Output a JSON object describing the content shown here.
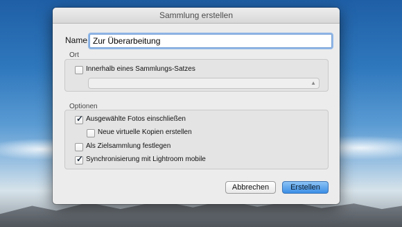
{
  "dialog": {
    "title": "Sammlung erstellen",
    "name_label": "Name:",
    "name_value": "Zur Überarbeitung"
  },
  "ort": {
    "label": "Ort",
    "inside_set_label": "Innerhalb eines Sammlungs-Satzes",
    "inside_set_checked": false,
    "set_select_value": ""
  },
  "optionen": {
    "label": "Optionen",
    "items": [
      {
        "label": "Ausgewählte Fotos einschließen",
        "checked": true
      },
      {
        "label": "Neue virtuelle Kopien erstellen",
        "checked": false
      },
      {
        "label": "Als Zielsammlung festlegen",
        "checked": false
      },
      {
        "label": "Synchronisierung mit Lightroom mobile",
        "checked": true
      }
    ]
  },
  "buttons": {
    "cancel": "Abbrechen",
    "create": "Erstellen"
  }
}
